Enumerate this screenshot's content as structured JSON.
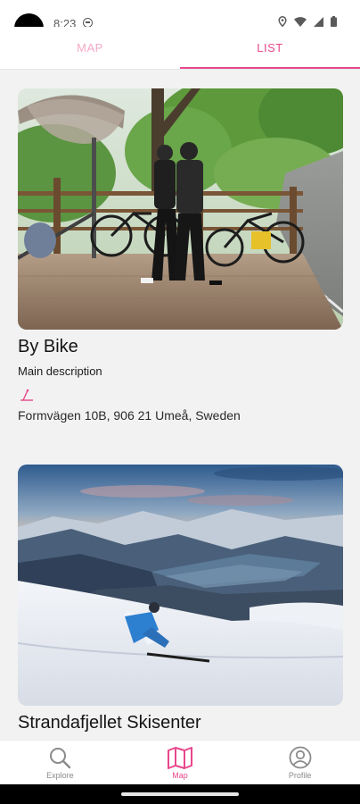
{
  "status_bar": {
    "time": "8:23",
    "icons": [
      "do-not-disturb-icon",
      "location-icon",
      "wifi-icon",
      "signal-icon",
      "battery-icon"
    ]
  },
  "tabs": [
    {
      "label": "MAP",
      "active": false
    },
    {
      "label": "LIST",
      "active": true
    }
  ],
  "places": [
    {
      "title": "By Bike",
      "description": "Main description",
      "address": "Formvägen 10B, 906 21 Umeå, Sweden",
      "image": "two-cyclists-on-wooden-deck-photo"
    },
    {
      "title": "Strandafjellet Skisenter",
      "image": "skier-on-snowy-slope-above-fjord-photo"
    }
  ],
  "bottom_nav": [
    {
      "label": "Explore",
      "icon": "search-icon",
      "active": false
    },
    {
      "label": "Map",
      "icon": "map-icon",
      "active": true
    },
    {
      "label": "Profile",
      "icon": "profile-icon",
      "active": false
    }
  ],
  "colors": {
    "accent": "#e8478b",
    "accent_light": "#f4a9c8",
    "background": "#f2f2f2"
  }
}
